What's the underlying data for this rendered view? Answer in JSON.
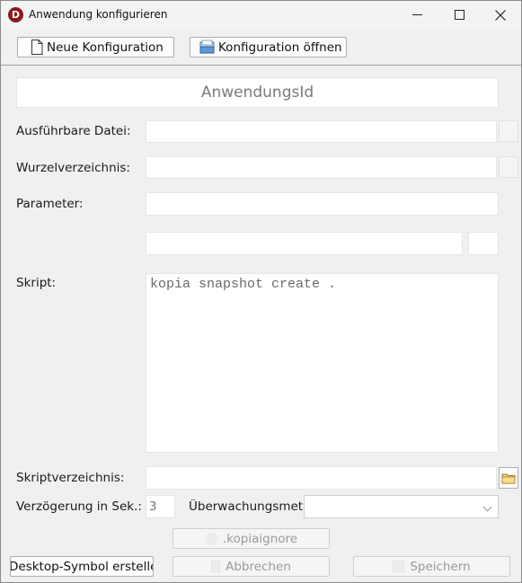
{
  "window": {
    "title": "Anwendung konfigurieren",
    "app_icon_letter": "D",
    "accent_color": "#8b1a1a"
  },
  "toolbar": {
    "new_config_label": "Neue Konfiguration",
    "new_config_icon": "document-icon",
    "open_config_label": "Konfiguration öffnen",
    "open_config_icon": "open-folder-icon"
  },
  "form": {
    "app_id_placeholder": "AnwendungsId",
    "executable_label": "Ausführbare Datei:",
    "executable_value": "",
    "root_dir_label": "Wurzelverzeichnis:",
    "root_dir_value": "",
    "parameter_label": "Parameter:",
    "parameter_value": "",
    "extra_value": "",
    "extra_small_value": "",
    "script_label": "Skript:",
    "script_value": "kopia snapshot create .",
    "script_dir_label": "Skriptverzeichnis:",
    "script_dir_value": "",
    "delay_label": "Verzögerung in Sek.:",
    "delay_value": "3",
    "monitor_label": "Überwachungsmeth",
    "monitor_value": ""
  },
  "buttons": {
    "kopiaignore_label": ".kopiaignore",
    "desktop_label": "Desktop-Symbol erstellen",
    "cancel_label": "Abbrechen",
    "save_label": "Speichern"
  }
}
